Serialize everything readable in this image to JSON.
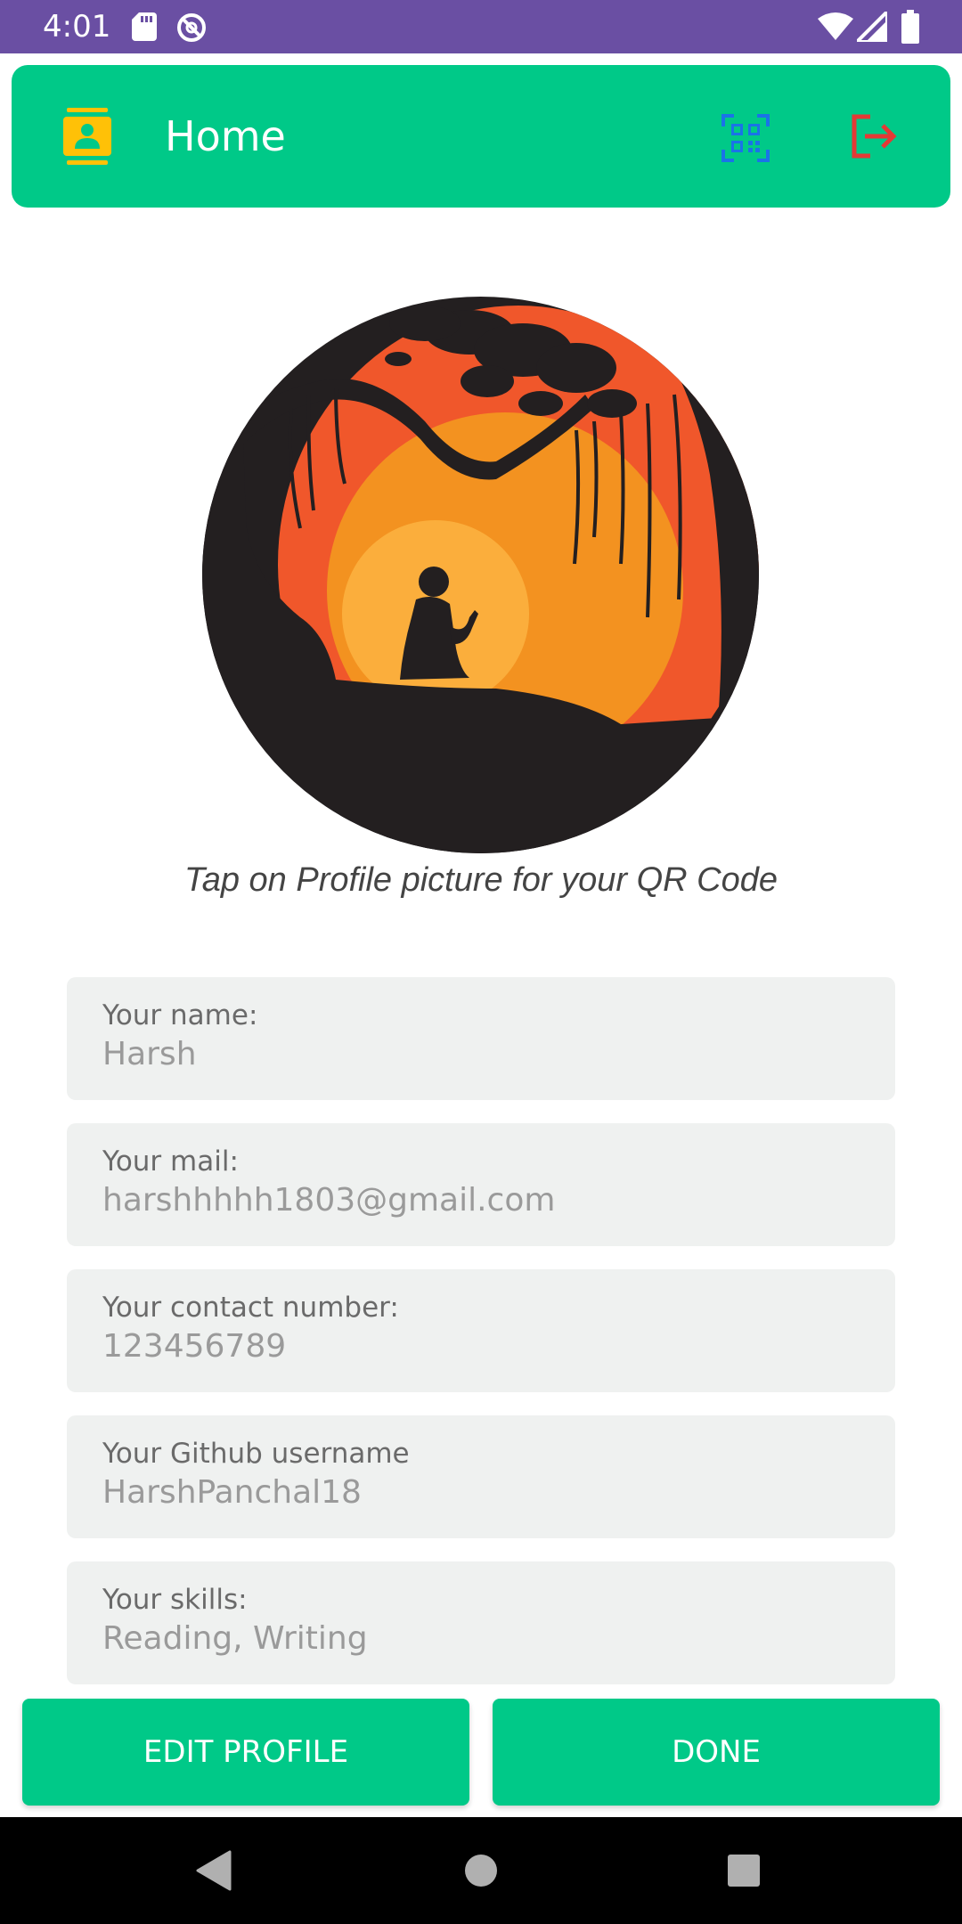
{
  "status_bar": {
    "time": "4:01",
    "icons": [
      "sd-card-icon",
      "do-not-disturb-icon",
      "wifi-icon",
      "signal-icon",
      "battery-icon"
    ]
  },
  "app_bar": {
    "title": "Home",
    "left_icon": "contact-icon",
    "actions": [
      "qr-code-icon",
      "logout-icon"
    ],
    "colors": {
      "background": "#00c988",
      "contact_icon": "#ffc107",
      "qr_icon": "#1a73e8",
      "logout_icon": "#e53935"
    }
  },
  "profile": {
    "hint": "Tap on Profile picture for your QR Code"
  },
  "fields": [
    {
      "label": "Your name:",
      "value": "Harsh"
    },
    {
      "label": "Your mail:",
      "value": "harshhhhh1803@gmail.com"
    },
    {
      "label": "Your contact number:",
      "value": "123456789"
    },
    {
      "label": "Your Github username",
      "value": "HarshPanchal18"
    },
    {
      "label": "Your skills:",
      "value": "Reading, Writing"
    }
  ],
  "buttons": {
    "edit": "EDIT PROFILE",
    "done": "DONE"
  },
  "nav_bar": {
    "icons": [
      "back-icon",
      "home-icon",
      "recents-icon"
    ]
  },
  "colors": {
    "status_bar": "#6a4fa3",
    "accent": "#00c988",
    "field_background": "#eff1f0"
  }
}
